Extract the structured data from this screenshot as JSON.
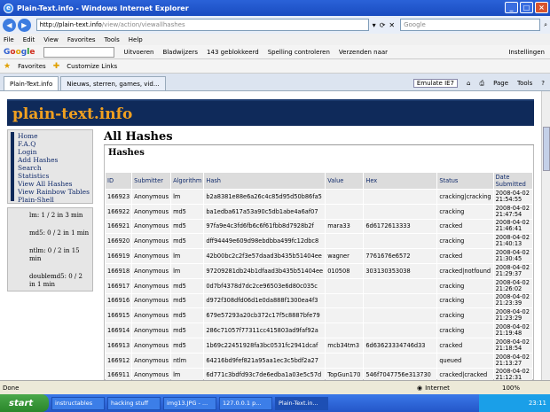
{
  "window": {
    "title": "Plain-Text.info - Windows Internet Explorer"
  },
  "address": {
    "url_main": "http://plain-text.info",
    "url_path": "/view/action/viewallhashes",
    "search_placeholder": "Google"
  },
  "menu": [
    "File",
    "Edit",
    "View",
    "Favorites",
    "Tools",
    "Help"
  ],
  "google_bar": {
    "logo": [
      "G",
      "o",
      "o",
      "g",
      "l",
      "e"
    ],
    "items": [
      "Uitvoeren",
      "Bladwijzers",
      "143 geblokkeerd",
      "Spelling controleren",
      "Verzenden naar"
    ],
    "settings": "Instellingen"
  },
  "favorites_bar": {
    "favorites_label": "Favorites",
    "customize_label": "Customize Links"
  },
  "tabs": [
    {
      "label": "Plain-Text.info"
    },
    {
      "label": "Nieuws, sterren, games, vid..."
    }
  ],
  "tab_tools": {
    "emulate": "Emulate IE7",
    "page": "Page",
    "tools": "Tools"
  },
  "site": {
    "title": "plain-text.info",
    "nav": [
      "Home",
      "F.A.Q",
      "Login",
      "Add Hashes",
      "Search",
      "Statistics",
      "View All Hashes",
      "View Rainbow Tables",
      "Plain-Shell"
    ],
    "stats": [
      "lm: 1 / 2 in 3 min",
      "md5: 0 / 2 in 1 min",
      "ntlm: 0 / 2 in 15 min",
      "doublemd5: 0 / 2 in 1 min"
    ],
    "page_title": "All Hashes",
    "section_title": "Hashes",
    "table": {
      "columns": [
        "ID",
        "Submitter",
        "Algorithm",
        "Hash",
        "Value",
        "Hex",
        "Status",
        "Date Submitted"
      ],
      "rows": [
        [
          "166923",
          "Anonymous",
          "lm",
          "b2a8381e88e6a26c4c85d95d50b86fa5",
          "",
          "",
          "cracking|cracking",
          "2008-04-02 21:54:55"
        ],
        [
          "166922",
          "Anonymous",
          "md5",
          "ba1edba617a53a90c5db1abe4a6af07",
          "",
          "",
          "cracking",
          "2008-04-02 21:47:54"
        ],
        [
          "166921",
          "Anonymous",
          "md5",
          "97fa9e4c3fd6fb6c6f61fbb8d7928b2f",
          "mara33",
          "6d6172613333",
          "cracked",
          "2008-04-02 21:46:41"
        ],
        [
          "166920",
          "Anonymous",
          "md5",
          "dff94449e609d98ebdbba499fc12dbc8",
          "",
          "",
          "cracking",
          "2008-04-02 21:40:13"
        ],
        [
          "166919",
          "Anonymous",
          "lm",
          "42b00bc2c2f3e57daad3b435b51404ee",
          "wagner",
          "7761676e6572",
          "cracked",
          "2008-04-02 21:30:45"
        ],
        [
          "166918",
          "Anonymous",
          "lm",
          "97209281db24b1dfaad3b435b51404ee",
          "010508",
          "303130353038",
          "cracked|notfound",
          "2008-04-02 21:29:37"
        ],
        [
          "166917",
          "Anonymous",
          "md5",
          "0d7bf4378d7dc2ce96503e6d80c035c",
          "",
          "",
          "cracking",
          "2008-04-02 21:26:02"
        ],
        [
          "166916",
          "Anonymous",
          "md5",
          "d972f308dfd06d1e0da888f1300ea4f3",
          "",
          "",
          "cracking",
          "2008-04-02 21:23:39"
        ],
        [
          "166915",
          "Anonymous",
          "md5",
          "679e57293a20cb372c17f5c8887bfe79",
          "",
          "",
          "cracking",
          "2008-04-02 21:23:29"
        ],
        [
          "166914",
          "Anonymous",
          "md5",
          "286c71057f77311cc415803ad9faf92a",
          "",
          "",
          "cracking",
          "2008-04-02 21:19:48"
        ],
        [
          "166913",
          "Anonymous",
          "md5",
          "1b69c22451928fa3bc0531fc2941dcaf",
          "mcb34tm3",
          "6d63623334746d33",
          "cracked",
          "2008-04-02 21:18:54"
        ],
        [
          "166912",
          "Anonymous",
          "ntlm",
          "64216bd9fef821a95aa1ec3c5bdf2a27",
          "",
          "",
          "queued",
          "2008-04-02 21:13:27"
        ],
        [
          "166911",
          "Anonymous",
          "lm",
          "6d771c3bdfd93c7de6edba1a03e5c57d",
          "TopGun170",
          "546f7047756e313730",
          "cracked|cracked",
          "2008-04-02 21:12:31"
        ]
      ]
    }
  },
  "statusbar": {
    "left": "Done",
    "zone": "Internet",
    "zoom": "100%"
  },
  "taskbar": {
    "start": "start",
    "tasks": [
      "instructables",
      "hacking stuff",
      "img13.JPG - ...",
      "127.0.0.1 p...",
      "Plain-Text.in..."
    ],
    "clock": "23:11"
  }
}
